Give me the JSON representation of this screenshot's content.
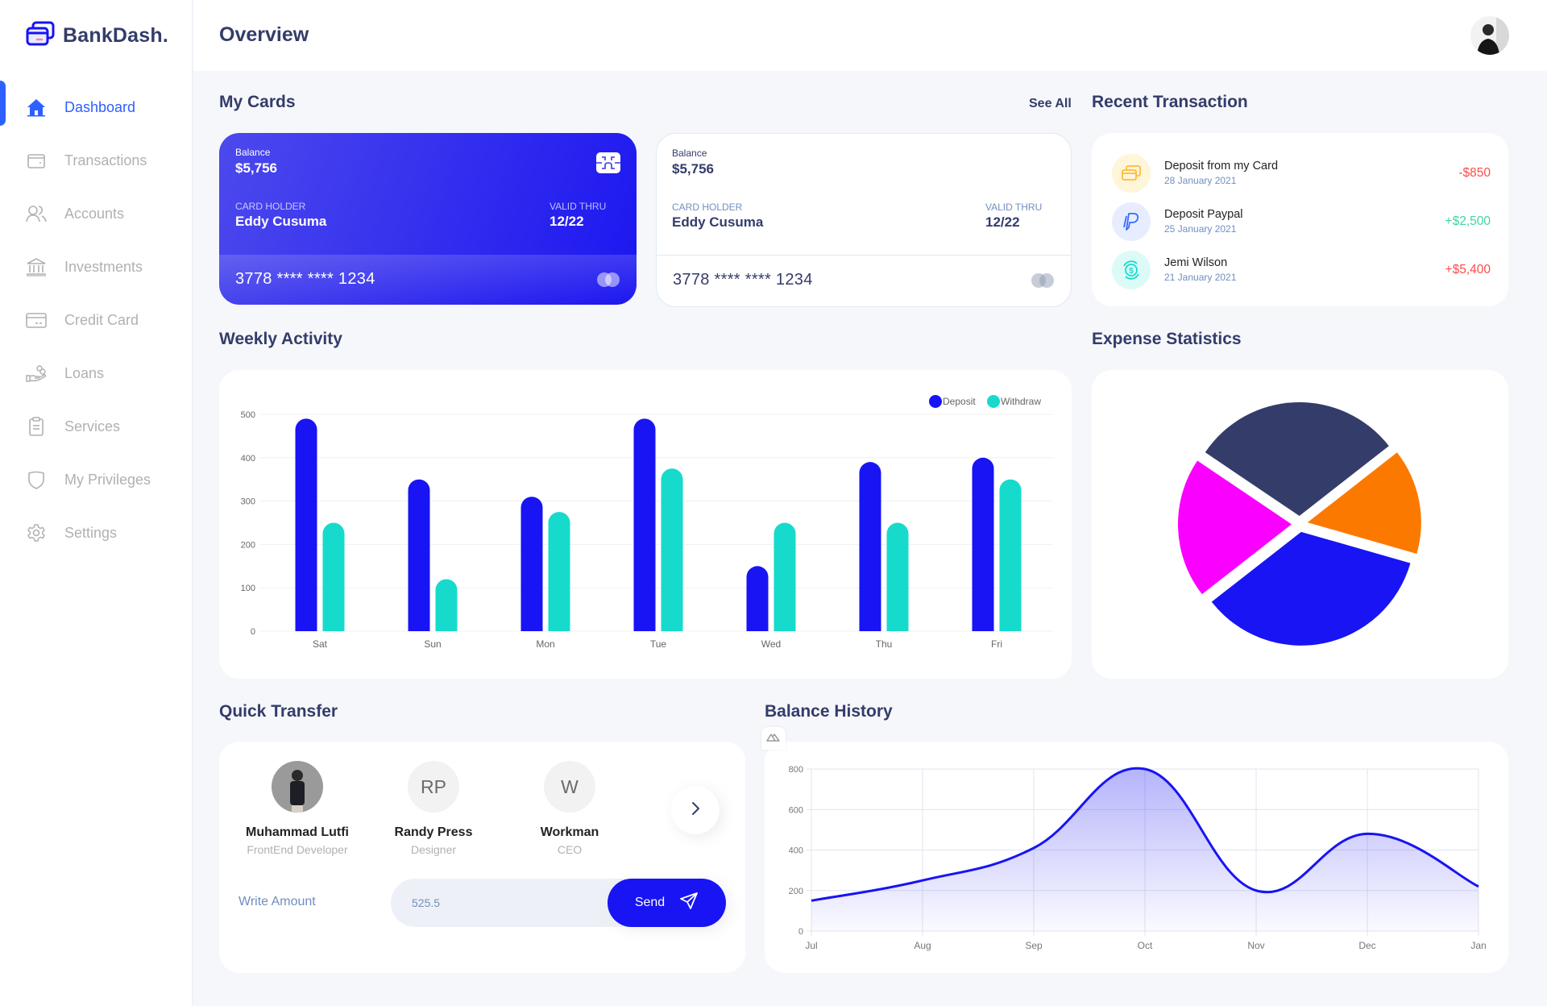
{
  "app": {
    "name": "BankDash."
  },
  "header": {
    "title": "Overview"
  },
  "sidebar": {
    "items": [
      {
        "label": "Dashboard",
        "icon": "home-icon",
        "active": true
      },
      {
        "label": "Transactions",
        "icon": "wallet-icon",
        "active": false
      },
      {
        "label": "Accounts",
        "icon": "users-icon",
        "active": false
      },
      {
        "label": "Investments",
        "icon": "bank-icon",
        "active": false
      },
      {
        "label": "Credit Card",
        "icon": "credit-card-icon",
        "active": false
      },
      {
        "label": "Loans",
        "icon": "loan-hand-icon",
        "active": false
      },
      {
        "label": "Services",
        "icon": "clipboard-icon",
        "active": false
      },
      {
        "label": "My Privileges",
        "icon": "shield-icon",
        "active": false
      },
      {
        "label": "Settings",
        "icon": "gear-icon",
        "active": false
      }
    ]
  },
  "my_cards": {
    "title": "My Cards",
    "see_all": "See All",
    "cards": [
      {
        "balance_label": "Balance",
        "balance": "$5,756",
        "holder_label": "CARD HOLDER",
        "holder": "Eddy Cusuma",
        "valid_label": "VALID THRU",
        "valid": "12/22",
        "number": "3778 **** **** 1234",
        "style": "dark"
      },
      {
        "balance_label": "Balance",
        "balance": "$5,756",
        "holder_label": "CARD HOLDER",
        "holder": "Eddy Cusuma",
        "valid_label": "VALID THRU",
        "valid": "12/22",
        "number": "3778 **** **** 1234",
        "style": "light"
      }
    ]
  },
  "recent_transaction": {
    "title": "Recent Transaction",
    "items": [
      {
        "title": "Deposit from my Card",
        "date": "28 January 2021",
        "amount": "-$850",
        "amount_color": "#FF4B4A",
        "icon": "card-icon",
        "icon_bg": "#FFF5D9",
        "icon_color": "#FFBB38"
      },
      {
        "title": "Deposit Paypal",
        "date": "25 January 2021",
        "amount": "+$2,500",
        "amount_color": "#41D4A8",
        "icon": "paypal-icon",
        "icon_bg": "#E7EDFF",
        "icon_color": "#396AFF"
      },
      {
        "title": "Jemi Wilson",
        "date": "21 January 2021",
        "amount": "+$5,400",
        "amount_color": "#FF4B4A",
        "icon": "dollar-coin-icon",
        "icon_bg": "#DCFAF8",
        "icon_color": "#16DBCC"
      }
    ]
  },
  "weekly_activity": {
    "title": "Weekly Activity"
  },
  "expense_statistics": {
    "title": "Expense Statistics"
  },
  "quick_transfer": {
    "title": "Quick Transfer",
    "people": [
      {
        "name": "Muhammad Lutfi",
        "role": "FrontEnd Developer",
        "initials": "",
        "has_photo": true
      },
      {
        "name": "Randy Press",
        "role": "Designer",
        "initials": "RP",
        "has_photo": false
      },
      {
        "name": "Workman",
        "role": "CEO",
        "initials": "W",
        "has_photo": false
      }
    ],
    "amount_label": "Write Amount",
    "amount_value": "525.5",
    "send_label": "Send"
  },
  "balance_history": {
    "title": "Balance History"
  },
  "colors": {
    "primary": "#1814F3",
    "accent": "#2D60FF",
    "teal": "#16DBCC",
    "navy": "#343C6A",
    "orange": "#FC7900",
    "magenta": "#FA00FF"
  },
  "chart_data": [
    {
      "id": "weekly_activity",
      "type": "bar",
      "title": "Weekly Activity",
      "categories": [
        "Sat",
        "Sun",
        "Mon",
        "Tue",
        "Wed",
        "Thu",
        "Fri"
      ],
      "series": [
        {
          "name": "Deposit",
          "color": "#1814F3",
          "values": [
            490,
            350,
            310,
            490,
            150,
            390,
            400
          ]
        },
        {
          "name": "Withdraw",
          "color": "#16DBCC",
          "values": [
            250,
            120,
            275,
            375,
            250,
            250,
            350
          ]
        }
      ],
      "yticks": [
        0,
        100,
        200,
        300,
        400,
        500
      ],
      "ylim": [
        0,
        500
      ],
      "grid": true,
      "legend": "top-right",
      "xlabel": "",
      "ylabel": ""
    },
    {
      "id": "expense_statistics",
      "type": "pie",
      "title": "Expense Statistics",
      "slices": [
        {
          "value": 30,
          "color": "#343C6A"
        },
        {
          "value": 15,
          "color": "#FC7900"
        },
        {
          "value": 35,
          "color": "#1814F3"
        },
        {
          "value": 20,
          "color": "#FA00FF"
        }
      ],
      "labels_shown": false
    },
    {
      "id": "balance_history",
      "type": "area",
      "title": "Balance History",
      "x": [
        "Jul",
        "Aug",
        "Sep",
        "Oct",
        "Nov",
        "Dec",
        "Jan"
      ],
      "values": [
        150,
        250,
        410,
        800,
        200,
        480,
        220
      ],
      "yticks": [
        0,
        200,
        400,
        600,
        800
      ],
      "ylim": [
        0,
        800
      ],
      "grid": true,
      "color": "#1814F3"
    }
  ]
}
